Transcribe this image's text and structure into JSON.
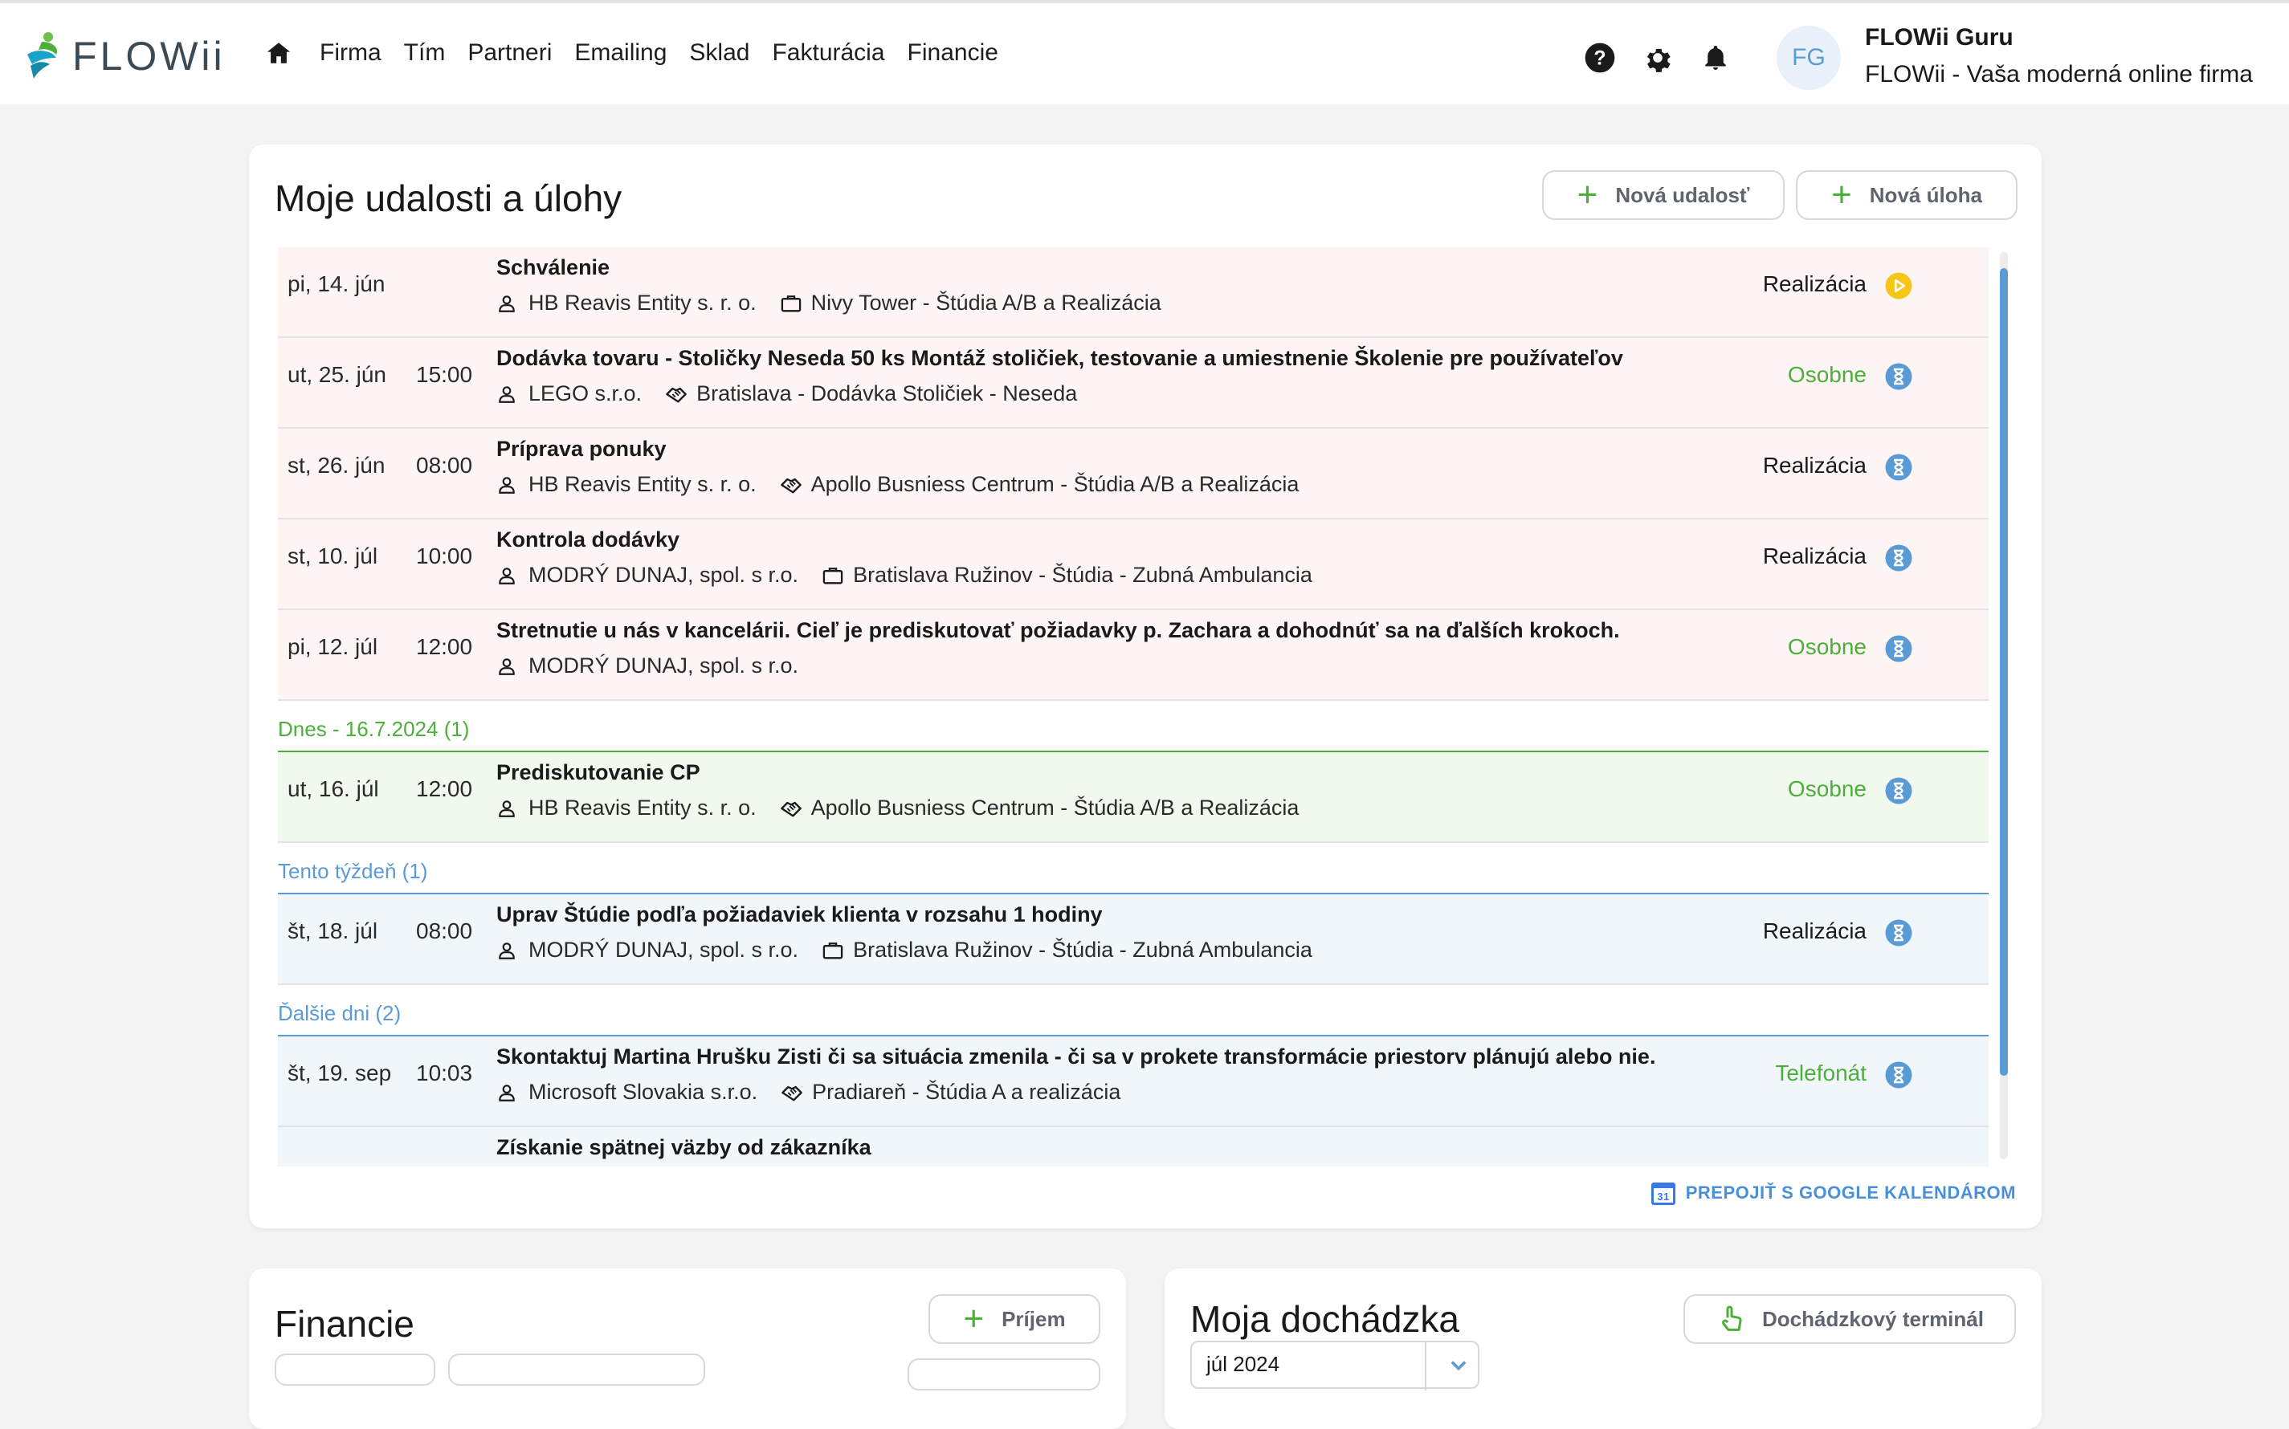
{
  "app": {
    "logo_text": "FLOWii",
    "nav": [
      "Firma",
      "Tím",
      "Partneri",
      "Emailing",
      "Sklad",
      "Fakturácia",
      "Financie"
    ],
    "user": {
      "initials": "FG",
      "name": "FLOWii Guru",
      "company": "FLOWii - Vaša moderná online firma"
    }
  },
  "events_card": {
    "title": "Moje udalosti a úlohy",
    "new_event_label": "Nová udalosť",
    "new_task_label": "Nová úloha",
    "google_calendar_label": "PREPOJIŤ S GOOGLE KALENDÁROM",
    "google_calendar_icon_text": "31",
    "rows_past": [
      {
        "date": "pi, 14. jún",
        "time": "",
        "title": "Schválenie",
        "contact": "HB Reavis Entity s. r. o.",
        "project_icon": "briefcase-icon",
        "project": "Nivy Tower - Štúdia A/B a Realizácia",
        "type": "Realizácia",
        "type_color": "dark",
        "status_icon": "play-icon"
      },
      {
        "date": "ut, 25. jún",
        "time": "15:00",
        "title": "Dodávka tovaru - Stoličky Neseda 50 ks Montáž stoličiek, testovanie a umiestnenie Školenie pre používateľov",
        "contact": "LEGO s.r.o.",
        "project_icon": "handshake-icon",
        "project": "Bratislava - Dodávka Stoličiek - Neseda",
        "type": "Osobne",
        "type_color": "green",
        "status_icon": "hourglass-icon"
      },
      {
        "date": "st, 26. jún",
        "time": "08:00",
        "title": "Príprava ponuky",
        "contact": "HB Reavis Entity s. r. o.",
        "project_icon": "handshake-icon",
        "project": "Apollo Busniess Centrum - Štúdia A/B a Realizácia",
        "type": "Realizácia",
        "type_color": "dark",
        "status_icon": "hourglass-icon"
      },
      {
        "date": "st, 10. júl",
        "time": "10:00",
        "title": "Kontrola dodávky",
        "contact": "MODRÝ DUNAJ, spol. s r.o.",
        "project_icon": "briefcase-icon",
        "project": "Bratislava Ružinov - Štúdia - Zubná Ambulancia",
        "type": "Realizácia",
        "type_color": "dark",
        "status_icon": "hourglass-icon"
      },
      {
        "date": "pi, 12. júl",
        "time": "12:00",
        "title": "Stretnutie u nás v kancelárii. Cieľ je prediskutovať požiadavky p. Zachara a dohodnúť sa na ďalších krokoch.",
        "contact": "MODRÝ DUNAJ, spol. s r.o.",
        "project_icon": "",
        "project": "",
        "type": "Osobne",
        "type_color": "green",
        "status_icon": "hourglass-icon"
      }
    ],
    "group_today": "Dnes - 16.7.2024 (1)",
    "rows_today": [
      {
        "date": "ut, 16. júl",
        "time": "12:00",
        "title": "Prediskutovanie CP",
        "contact": "HB Reavis Entity s. r. o.",
        "project_icon": "handshake-icon",
        "project": "Apollo Busniess Centrum - Štúdia A/B a Realizácia",
        "type": "Osobne",
        "type_color": "green",
        "status_icon": "hourglass-icon"
      }
    ],
    "group_week": "Tento týždeň (1)",
    "rows_week": [
      {
        "date": "št, 18. júl",
        "time": "08:00",
        "title": "Uprav Štúdie podľa požiadaviek klienta v rozsahu 1 hodiny",
        "contact": "MODRÝ DUNAJ, spol. s r.o.",
        "project_icon": "briefcase-icon",
        "project": "Bratislava Ružinov - Štúdia - Zubná Ambulancia",
        "type": "Realizácia",
        "type_color": "dark",
        "status_icon": "hourglass-icon"
      }
    ],
    "group_next": "Ďalšie dni (2)",
    "rows_next": [
      {
        "date": "št, 19. sep",
        "time": "10:03",
        "title": "Skontaktuj Martina Hrušku Zisti či sa situácia zmenila - či sa v prokete transformácie priestorv plánujú alebo nie.",
        "contact": "Microsoft Slovakia s.r.o.",
        "project_icon": "handshake-icon",
        "project": "Pradiareň - Štúdia A a realizácia",
        "type": "Telefonát",
        "type_color": "green",
        "status_icon": "hourglass-icon"
      },
      {
        "date": "",
        "time": "",
        "title": "Získanie spätnej väzby od zákazníka",
        "contact": "",
        "project_icon": "",
        "project": "",
        "type": "",
        "type_color": "dark",
        "status_icon": ""
      }
    ]
  },
  "finance_card": {
    "title": "Financie",
    "income_label": "Príjem"
  },
  "attendance_card": {
    "title": "Moja dochádzka",
    "terminal_label": "Dochádzkový terminál",
    "month_value": "júl 2024"
  },
  "colors": {
    "accent_green": "#4caf3a",
    "accent_blue": "#5b9bd5",
    "status_yellow": "#f5c518"
  }
}
